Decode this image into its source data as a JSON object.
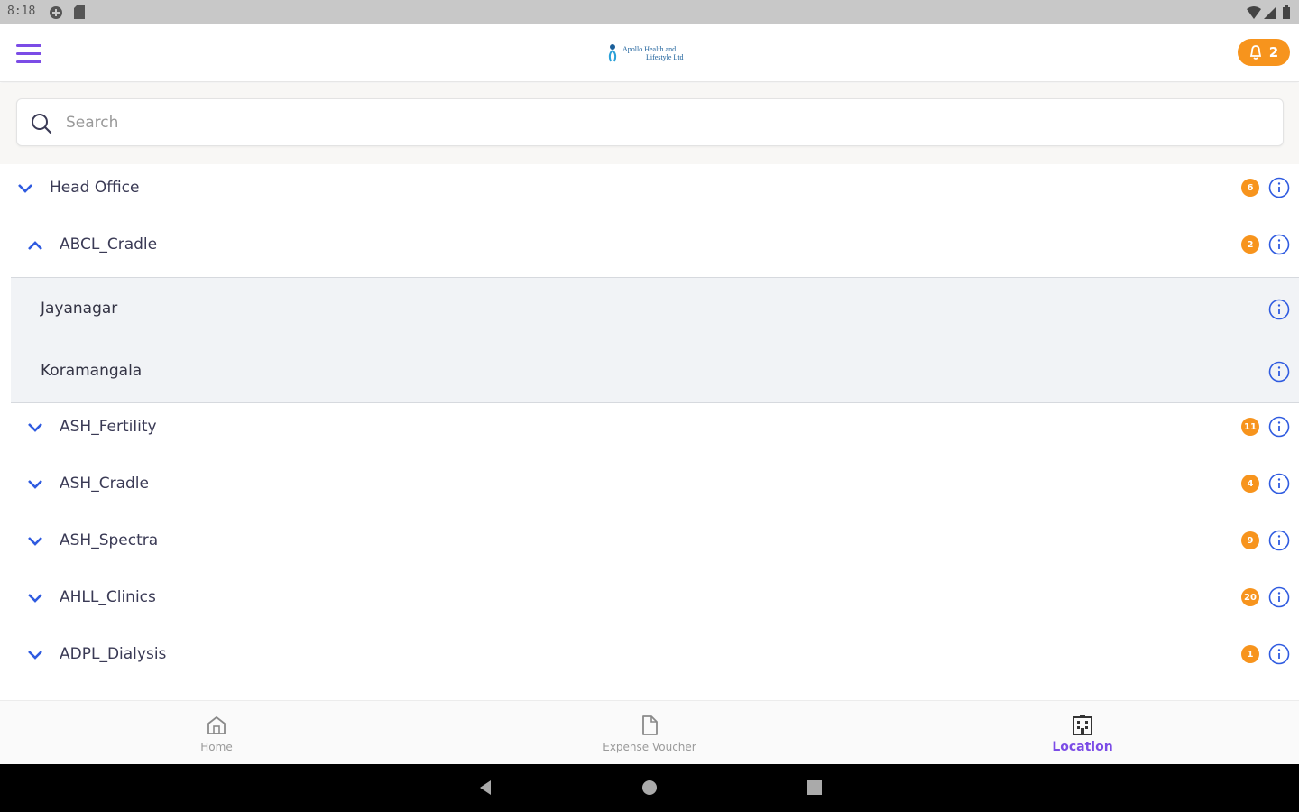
{
  "status_bar": {
    "time": "8:18"
  },
  "header": {
    "logo_text_line1": "Apollo Health and",
    "logo_text_line2": "Lifestyle Ltd",
    "notification_count": "2",
    "accent_color": "#7b4ce6",
    "badge_color": "#f7941d"
  },
  "search": {
    "placeholder": "Search"
  },
  "tree": {
    "head_office": {
      "label": "Head Office",
      "count": "6"
    },
    "abcl_cradle": {
      "label": "ABCL_Cradle",
      "count": "2"
    },
    "children": [
      {
        "label": "Jayanagar"
      },
      {
        "label": "Koramangala"
      }
    ],
    "items": [
      {
        "label": "ASH_Fertility",
        "count": "11"
      },
      {
        "label": "ASH_Cradle",
        "count": "4"
      },
      {
        "label": "ASH_Spectra",
        "count": "9"
      },
      {
        "label": "AHLL_Clinics",
        "count": "20"
      },
      {
        "label": "ADPL_Dialysis",
        "count": "1"
      }
    ]
  },
  "bottom_nav": {
    "home": "Home",
    "expense": "Expense Voucher",
    "location": "Location",
    "active": "location"
  }
}
